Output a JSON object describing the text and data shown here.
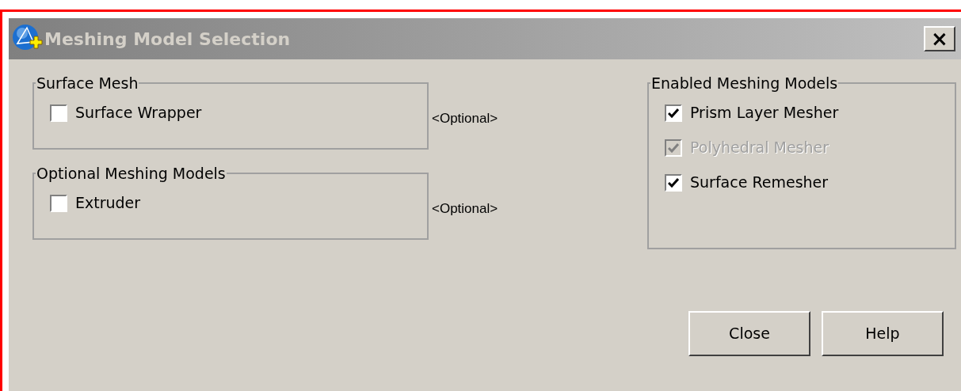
{
  "window": {
    "title": "Meshing Model Selection",
    "close_glyph": "×"
  },
  "left_groups": [
    {
      "title": "Surface Mesh",
      "note": "<Optional>",
      "items": [
        {
          "label": "Surface Wrapper",
          "checked": false,
          "disabled": false
        }
      ]
    },
    {
      "title": "Optional Meshing Models",
      "note": "<Optional>",
      "items": [
        {
          "label": "Extruder",
          "checked": false,
          "disabled": false
        }
      ]
    }
  ],
  "right_group": {
    "title": "Enabled Meshing Models",
    "items": [
      {
        "label": "Prism Layer Mesher",
        "checked": true,
        "disabled": false
      },
      {
        "label": "Polyhedral Mesher",
        "checked": true,
        "disabled": true
      },
      {
        "label": "Surface Remesher",
        "checked": true,
        "disabled": false
      }
    ]
  },
  "buttons": [
    "Close",
    "Help"
  ]
}
